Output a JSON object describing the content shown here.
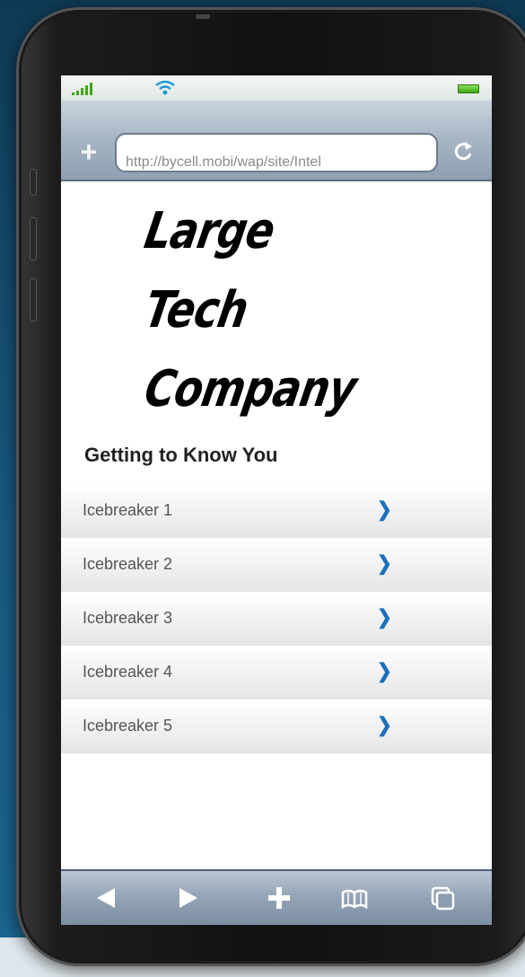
{
  "browser": {
    "url": "http://bycell.mobi/wap/site/Intel"
  },
  "page": {
    "logo_lines": [
      "Large",
      "Tech",
      "Company"
    ],
    "section_title": "Getting to Know You",
    "items": [
      {
        "label": "Icebreaker 1"
      },
      {
        "label": "Icebreaker 2"
      },
      {
        "label": "Icebreaker 3"
      },
      {
        "label": "Icebreaker 4"
      },
      {
        "label": "Icebreaker 5"
      }
    ]
  },
  "icons": {
    "status": [
      "signal-icon",
      "wifi-icon",
      "battery-icon"
    ],
    "urlbar": [
      "plus-icon",
      "reload-icon"
    ],
    "toolbar": [
      "back-arrow-icon",
      "forward-arrow-icon",
      "add-icon",
      "bookmarks-icon",
      "tabs-icon"
    ]
  },
  "colors": {
    "chevron": "#1c6fba",
    "battery": "#3fa616"
  }
}
